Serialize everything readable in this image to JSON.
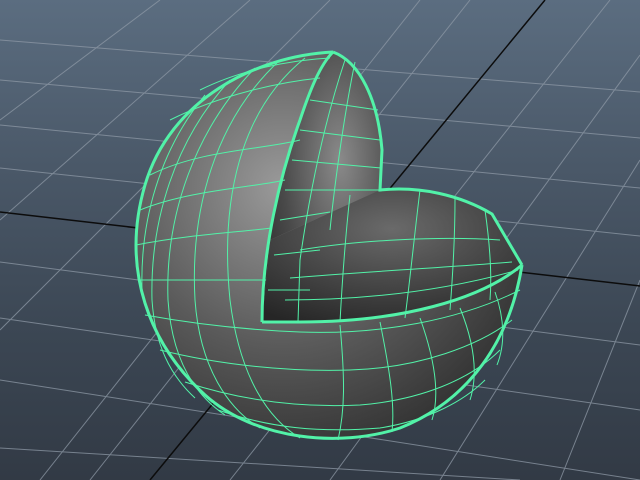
{
  "viewport": {
    "name": "3d-perspective-viewport",
    "background_top": "#5b6d80",
    "background_bottom": "#323a45"
  },
  "scene": {
    "grid": {
      "visible": true,
      "color": "#8e99a6",
      "axis_color": "#0c0c0c"
    },
    "object": {
      "type": "partial-sphere-wireframe",
      "selected": true,
      "wire_color": "#52f2a8",
      "shade_light": "#9a9a9a",
      "shade_dark": "#2e2e2e"
    }
  }
}
